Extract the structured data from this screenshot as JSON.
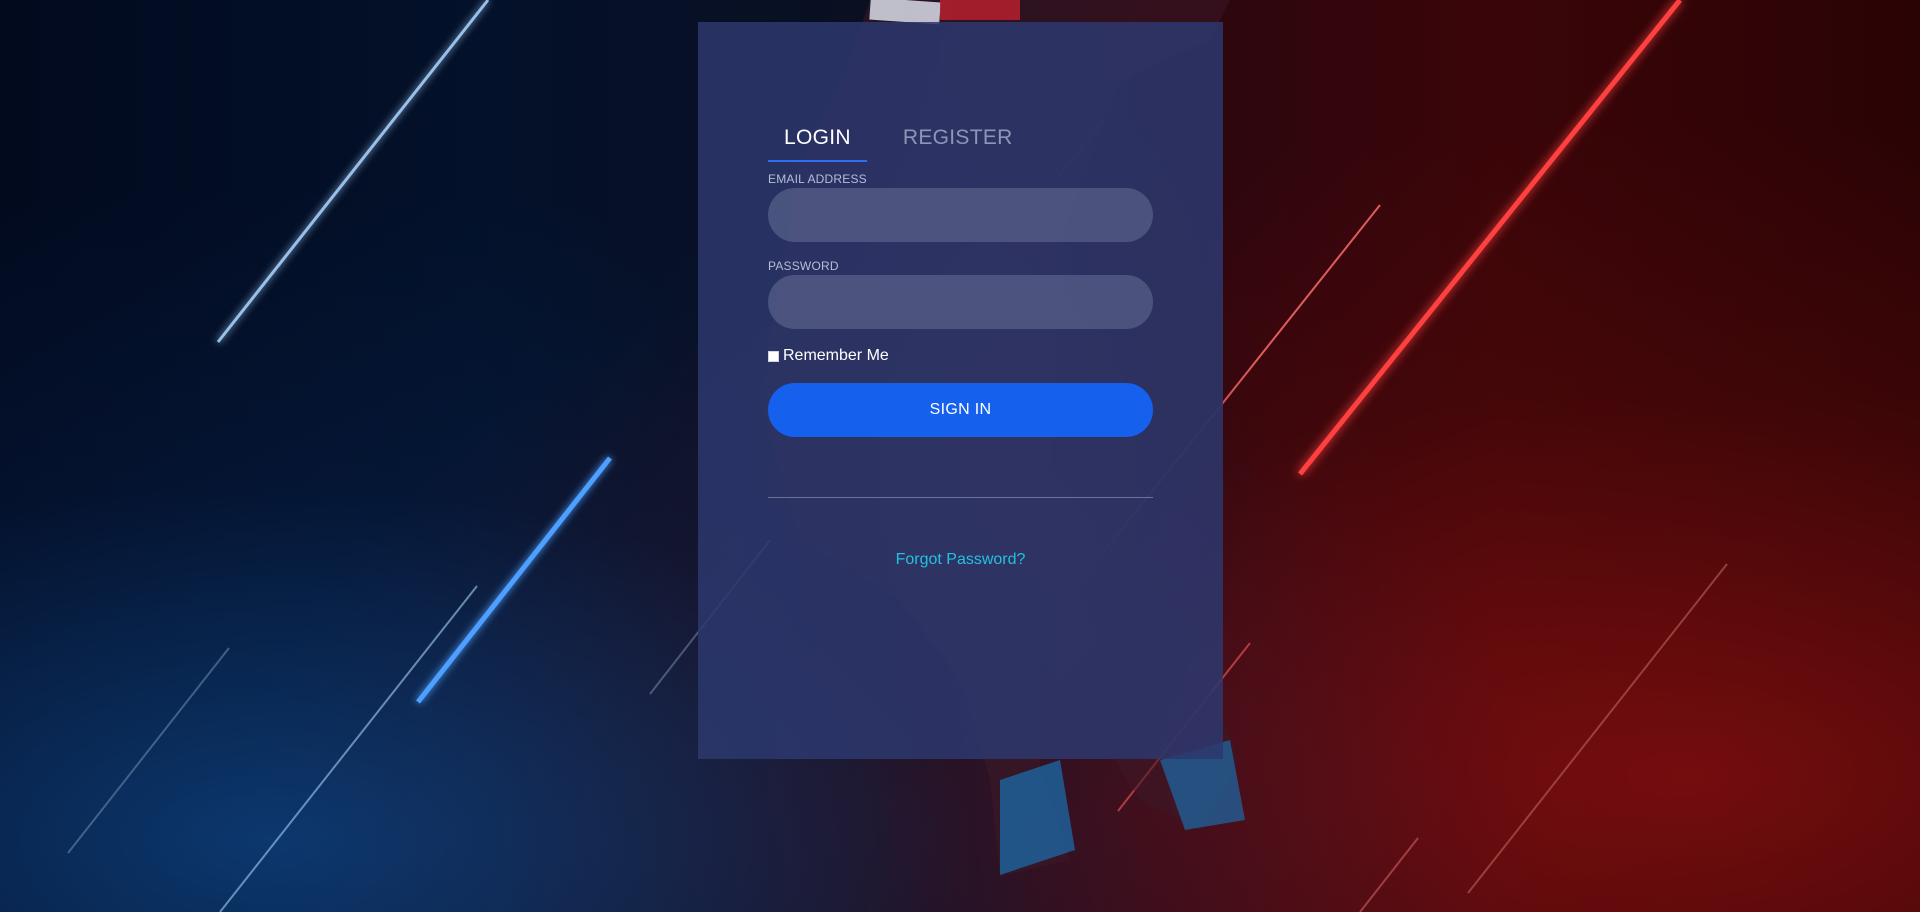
{
  "login": {
    "tabs": [
      {
        "label": "LOGIN",
        "active": true
      },
      {
        "label": "REGISTER",
        "active": false
      }
    ],
    "email": {
      "label": "EMAIL ADDRESS",
      "value": "",
      "placeholder": ""
    },
    "password": {
      "label": "PASSWORD",
      "value": "",
      "placeholder": ""
    },
    "remember_me": {
      "label": "Remember Me",
      "checked": false
    },
    "sign_in_label": "SIGN IN",
    "forgot_password_label": "Forgot Password?"
  },
  "colors": {
    "primary_button": "#1660ee",
    "active_tab_underline": "#2f6ef0",
    "link": "#24c1e0",
    "card_background": "#2c386e"
  },
  "background": {
    "icon": "neon-light-streaks",
    "left_glow": "#3a8cff",
    "right_glow": "#ff2a2a"
  }
}
